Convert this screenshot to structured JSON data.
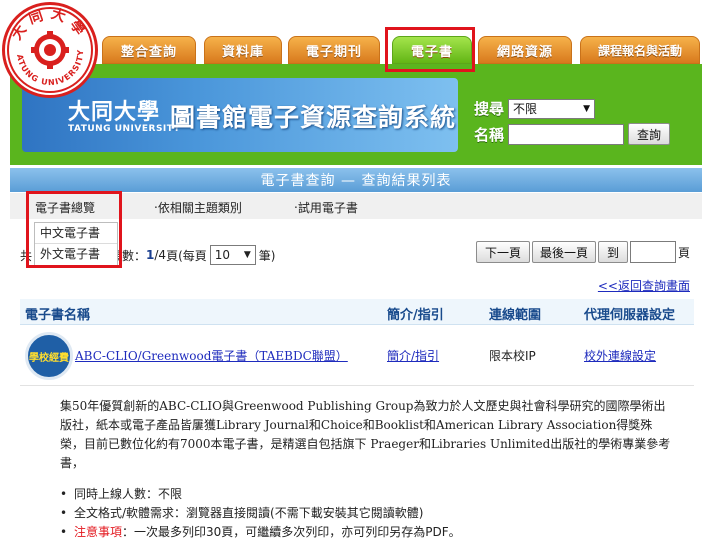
{
  "logo": {
    "text_cn": "大同大學",
    "text_en": "TATUNG UNIVERSITY"
  },
  "tabs": [
    {
      "label": "整合查詢",
      "active": false
    },
    {
      "label": "資料庫",
      "active": false
    },
    {
      "label": "電子期刊",
      "active": false
    },
    {
      "label": "電子書",
      "active": true
    },
    {
      "label": "網路資源",
      "active": false
    },
    {
      "label": "課程報名與活動",
      "active": false
    }
  ],
  "banner": {
    "school_cn": "大同大學",
    "school_en": "TATUNG UNIVERSITY",
    "title": "圖書館電子資源查詢系統"
  },
  "search": {
    "search_label": "搜尋",
    "search_select_value": "不限",
    "name_label": "名稱",
    "name_value": "",
    "submit_label": "查詢"
  },
  "subtitle": "電子書查詢 — 查詢結果列表",
  "nav": {
    "items": [
      "電子書總覽",
      "‧依相關主題類別",
      "‧試用電子書"
    ],
    "dropdown": [
      "中文電子書",
      "外文電子書"
    ]
  },
  "pager": {
    "prefix": "共",
    "pages_label": "頁數：",
    "current_page": "1",
    "total_pages": "/4",
    "per_page_prefix": "頁(每頁",
    "per_page_value": "10",
    "per_page_suffix": "筆)",
    "next_label": "下一頁",
    "last_label": "最後一頁",
    "goto_label": "到",
    "page_input": "",
    "page_suffix": "頁"
  },
  "back_link": "<<返回查詢畫面",
  "table": {
    "headers": [
      "電子書名稱",
      "簡介/指引",
      "連線範圍",
      "代理伺服器設定"
    ],
    "rows": [
      {
        "badge": "學校經費",
        "title": "ABC-CLIO/Greenwood電子書（TAEBDC聯盟）",
        "intro": "簡介/指引",
        "range": "限本校IP",
        "proxy": "校外連線設定",
        "description": "集50年優質創新的ABC-CLIO與Greenwood Publishing Group為致力於人文歷史與社會科學研究的國際學術出版社，紙本或電子產品皆屢獲Library Journal和Choice和Booklist和American Library Association得獎殊榮，目前已數位化約有7000本電子書，是精選自包括旗下 Praeger和Libraries Unlimited出版社的學術專業參考書，",
        "notes": [
          {
            "label": "",
            "text": "同時上線人數：不限"
          },
          {
            "label": "",
            "text": "全文格式/軟體需求：瀏覽器直接閱讀(不需下載安裝其它閱讀軟體)"
          },
          {
            "label": "注意事項",
            "text": "：一次最多列印30頁，可繼續多次列印，亦可列印另存為PDF。"
          }
        ]
      }
    ]
  },
  "colors": {
    "tab_orange": "#e8962e",
    "tab_green": "#7fcc2d",
    "band_green": "#5ab51e",
    "banner_blue": "#3b84cf",
    "highlight_red": "#e0141c",
    "link_blue": "#1e2bbd"
  }
}
